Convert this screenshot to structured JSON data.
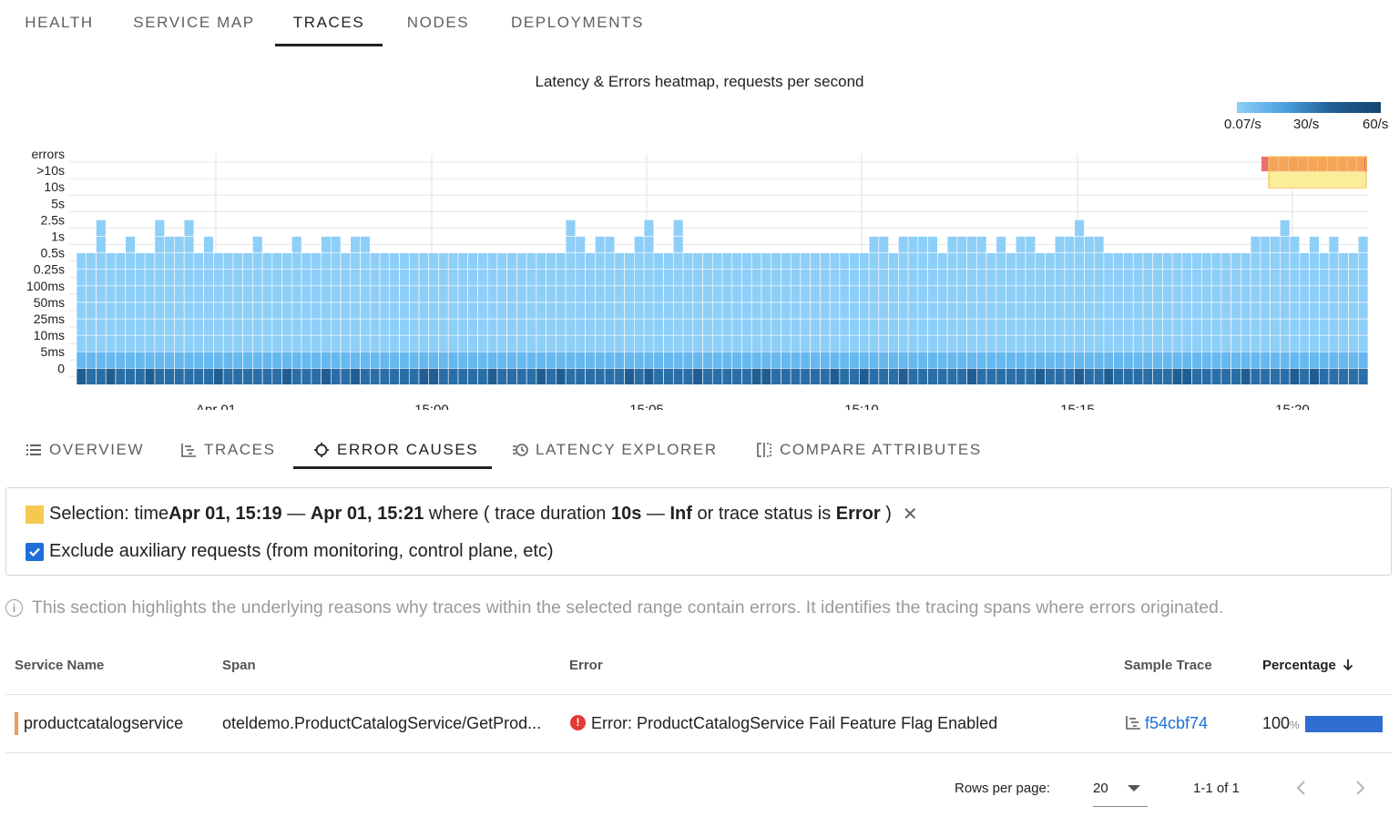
{
  "top_tabs": [
    {
      "label": "HEALTH",
      "active": false
    },
    {
      "label": "SERVICE MAP",
      "active": false
    },
    {
      "label": "TRACES",
      "active": true
    },
    {
      "label": "NODES",
      "active": false
    },
    {
      "label": "DEPLOYMENTS",
      "active": false
    }
  ],
  "heatmap": {
    "title": "Latency & Errors heatmap, requests per second",
    "legend": {
      "min": "0.07/s",
      "mid": "30/s",
      "max": "60/s"
    },
    "y_labels": [
      "errors",
      ">10s",
      "10s",
      "5s",
      "2.5s",
      "1s",
      "0.5s",
      "0.25s",
      "100ms",
      "50ms",
      "25ms",
      "10ms",
      "5ms",
      "0"
    ],
    "x_labels": [
      "Apr 01",
      "15:00",
      "15:05",
      "15:10",
      "15:15",
      "15:20"
    ],
    "colors": {
      "light": "#8ecff8",
      "mid": "#66b8ef",
      "dark": "#2a6ea8",
      "darker": "#1f5d92",
      "error": "#f4a457",
      "error_red": "#e8716d",
      "selection": "#fbee9a"
    }
  },
  "chart_data": {
    "type": "heatmap",
    "title": "Latency & Errors heatmap, requests per second",
    "y_buckets": [
      "0",
      "5ms",
      "10ms",
      "25ms",
      "50ms",
      "100ms",
      "0.25s",
      "0.5s",
      "1s",
      "2.5s",
      "5s",
      "10s",
      ">10s",
      "errors"
    ],
    "x_ticks": [
      "Apr 01",
      "15:00",
      "15:05",
      "15:10",
      "15:15",
      "15:20"
    ],
    "color_scale": {
      "min": "0.07/s",
      "mid": "30/s",
      "max": "60/s"
    },
    "column_top_bucket": [
      7,
      7,
      9,
      7,
      7,
      8,
      7,
      7,
      9,
      8,
      8,
      9,
      7,
      8,
      7,
      7,
      7,
      7,
      8,
      7,
      7,
      7,
      8,
      7,
      7,
      8,
      8,
      7,
      8,
      8,
      7,
      7,
      7,
      7,
      7,
      7,
      7,
      7,
      7,
      7,
      7,
      7,
      7,
      7,
      7,
      7,
      7,
      7,
      7,
      7,
      9,
      8,
      7,
      8,
      8,
      7,
      7,
      8,
      9,
      7,
      7,
      9,
      7,
      7,
      7,
      7,
      7,
      7,
      7,
      7,
      7,
      7,
      7,
      7,
      7,
      7,
      7,
      7,
      7,
      7,
      7,
      8,
      8,
      7,
      8,
      8,
      8,
      8,
      7,
      8,
      8,
      8,
      8,
      7,
      8,
      7,
      8,
      8,
      7,
      7,
      8,
      8,
      9,
      8,
      8,
      7,
      7,
      7,
      7,
      7,
      7,
      7,
      7,
      7,
      7,
      7,
      7,
      7,
      7,
      7,
      8,
      8,
      8,
      9,
      8,
      7,
      8,
      7,
      8,
      7,
      7,
      8
    ],
    "error_columns": "15:19 - 15:21",
    "grid": true
  },
  "sub_tabs": [
    {
      "label": "OVERVIEW",
      "icon": "list-icon",
      "active": false
    },
    {
      "label": "TRACES",
      "icon": "trace-icon",
      "active": false
    },
    {
      "label": "ERROR CAUSES",
      "icon": "crosshair-icon",
      "active": true
    },
    {
      "label": "LATENCY EXPLORER",
      "icon": "latency-icon",
      "active": false
    },
    {
      "label": "COMPARE ATTRIBUTES",
      "icon": "compare-icon",
      "active": false
    }
  ],
  "selection": {
    "prefix": "Selection: time ",
    "time_from": "Apr 01, 15:19",
    "dash1": " — ",
    "time_to": "Apr 01, 15:21",
    "where": " where ( trace duration ",
    "dur_from": "10s",
    "dash2": " — ",
    "dur_to": "Inf",
    "or_status": " or trace status is ",
    "status": "Error",
    "close_paren": " )",
    "close_icon": "close-icon",
    "checkbox_label": "Exclude auxiliary requests (from monitoring, control plane, etc)",
    "checkbox_checked": true
  },
  "info_text": "This section highlights the underlying reasons why traces within the selected range contain errors. It identifies the tracing spans where errors originated.",
  "table": {
    "headers": {
      "service": "Service Name",
      "span": "Span",
      "error": "Error",
      "sample": "Sample Trace",
      "percentage": "Percentage"
    },
    "rows": [
      {
        "service": "productcatalogservice",
        "span": "oteldemo.ProductCatalogService/GetProd...",
        "error": "Error: ProductCatalogService Fail Feature Flag Enabled",
        "sample_trace": "f54cbf74",
        "percentage": "100",
        "percentage_unit": "%",
        "percentage_value": 100
      }
    ]
  },
  "pagination": {
    "rows_label": "Rows per page:",
    "rows_value": "20",
    "range": "1-1 of 1"
  }
}
